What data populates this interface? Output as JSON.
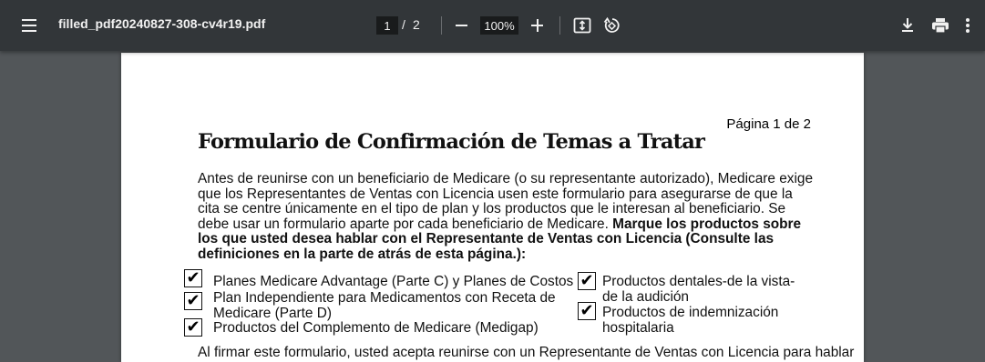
{
  "toolbar": {
    "filename": "filled_pdf20240827-308-cv4r19.pdf",
    "current_page": "1",
    "page_separator": "/",
    "total_pages": "2",
    "zoom": "100%",
    "icons": {
      "menu": "menu-icon",
      "zoom_out": "minus-icon",
      "zoom_in": "plus-icon",
      "fit": "fit-to-page-icon",
      "rotate": "rotate-icon",
      "download": "download-icon",
      "print": "print-icon",
      "more": "more-vert-icon"
    }
  },
  "colors": {
    "toolbar_bg": "#323639",
    "viewer_bg": "#525659",
    "page_bg": "#ffffff"
  },
  "document": {
    "page_label": "Página 1 de 2",
    "title": "Formulario de Confirmación de Temas a Tratar",
    "intro_plain": "Antes de reunirse con un beneficiario de Medicare (o su representante autorizado), Medicare exige que los Representantes de Ventas con Licencia usen este formulario para asegurarse de que la cita se centre únicamente en el tipo de plan y los productos que le interesan al beneficiario. Se debe usar un formulario aparte por cada beneficiario de Medicare. ",
    "intro_bold": "Marque los productos sobre los que usted desea hablar con el Representante de Ventas con Licencia (Consulte las definiciones en la parte de atrás de esta página.):",
    "options_left": [
      {
        "label": "Planes Medicare Advantage (Parte C) y Planes de Costos",
        "checked": true
      },
      {
        "label": "Plan Independiente para Medicamentos con Receta de Medicare (Parte D)",
        "checked": true
      },
      {
        "label": "Productos del Complemento de Medicare (Medigap)",
        "checked": true
      }
    ],
    "options_right": [
      {
        "label": "Productos dentales-de la vista-de la audición",
        "checked": true
      },
      {
        "label": "Productos de indemnización hospitalaria",
        "checked": true
      }
    ],
    "check_mark": "✔",
    "partial_line": "Al firmar este formulario, usted acepta reunirse con un Representante de Ventas con Licencia para hablar"
  }
}
